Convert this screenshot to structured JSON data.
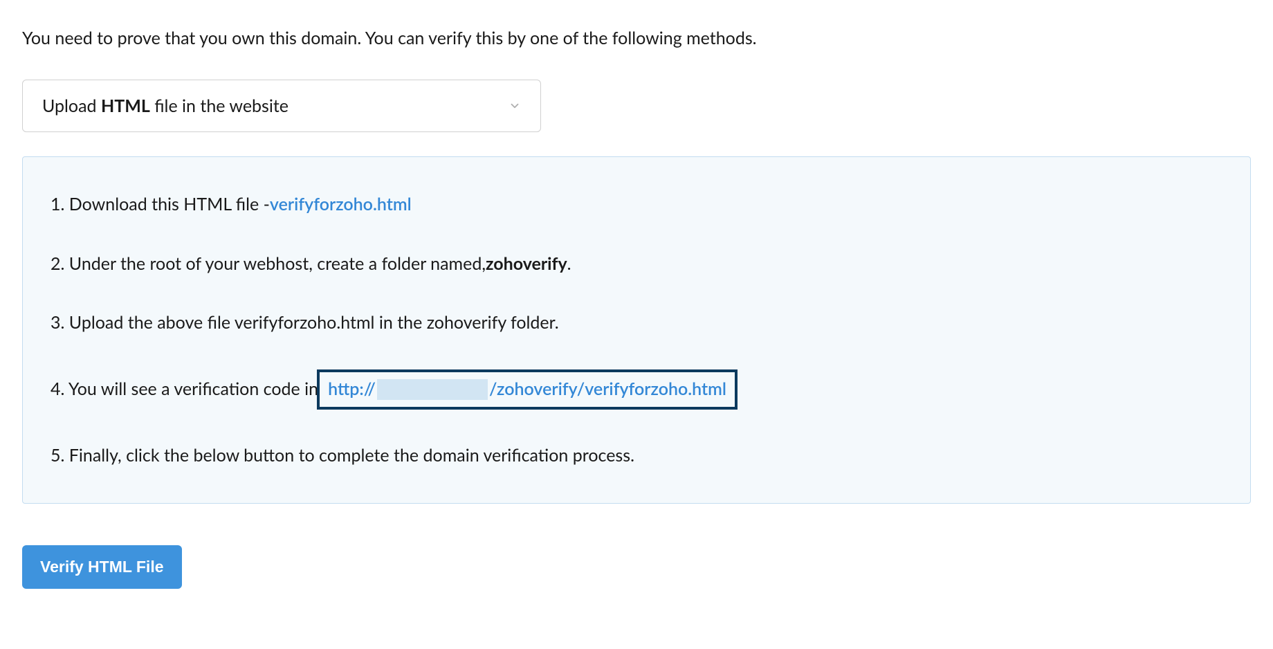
{
  "intro": "You need to prove that you own this domain. You can verify this by one of the following methods.",
  "dropdown": {
    "prefix": "Upload ",
    "bold": "HTML",
    "suffix": " file in the website"
  },
  "steps": {
    "s1_prefix": "1. Download this HTML file - ",
    "s1_link": "verifyforzoho.html",
    "s2_prefix": "2. Under the root of your webhost, create a folder named, ",
    "s2_bold": "zohoverify",
    "s2_suffix": ".",
    "s3": "3. Upload the above file verifyforzoho.html in the zohoverify folder.",
    "s4_prefix": "4. You will see a verification code in",
    "s4_url_proto": "http://",
    "s4_url_path": "/zohoverify/verifyforzoho.html",
    "s5": "5. Finally, click the below button to complete the domain verification process."
  },
  "button": "Verify HTML File"
}
